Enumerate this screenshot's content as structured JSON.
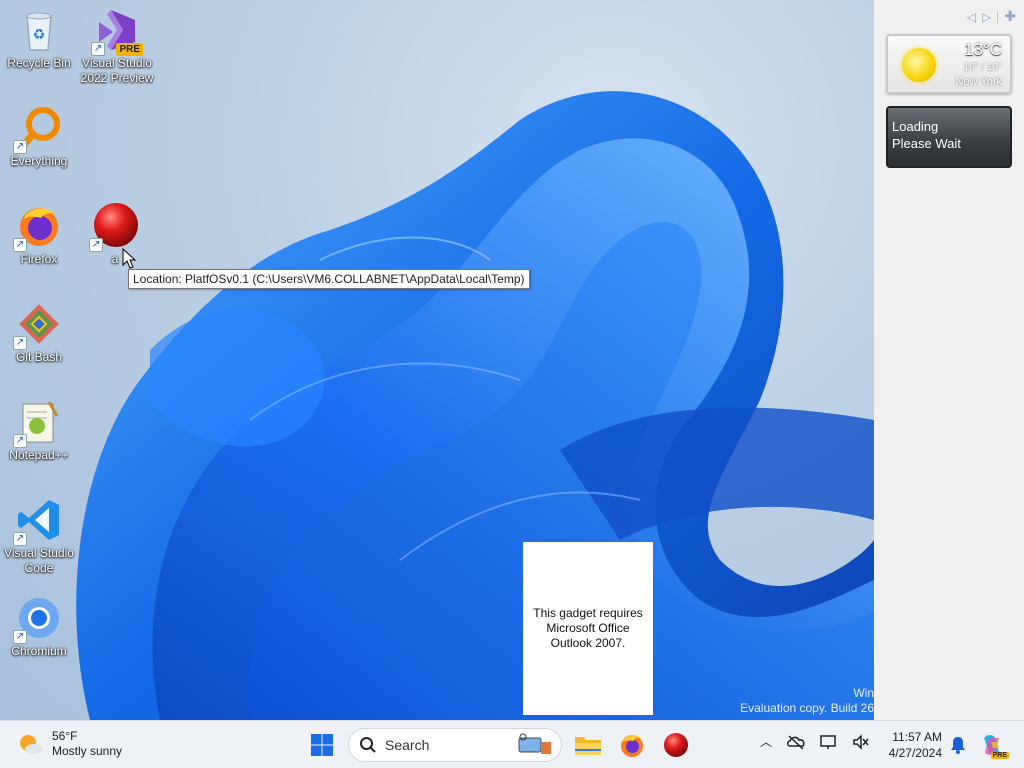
{
  "desktop": {
    "icons": [
      {
        "label": "Recycle Bin",
        "icon": "recycle-bin-icon"
      },
      {
        "label": "Visual Studio 2022 Preview",
        "icon": "visual-studio-icon",
        "badge": "PRE"
      },
      {
        "label": "Everything",
        "icon": "everything-search-icon"
      },
      {
        "label": "Firefox",
        "icon": "firefox-icon"
      },
      {
        "label": "a",
        "icon": "red-ball-icon"
      },
      {
        "label": "Git Bash",
        "icon": "git-bash-icon"
      },
      {
        "label": "Notepad++",
        "icon": "notepadpp-icon"
      },
      {
        "label": "Visual Studio Code",
        "icon": "vscode-icon"
      },
      {
        "label": "Chromium",
        "icon": "chromium-icon"
      }
    ],
    "tooltip": "Location: PlatfOSv0.1 (C:\\Users\\VM6.COLLABNET\\AppData\\Local\\Temp)",
    "outlook_gadget_text": "This gadget requires Microsoft Office Outlook 2007.",
    "watermark": {
      "line1": "Win",
      "line2": "Evaluation copy. Build 26"
    }
  },
  "sidebar": {
    "weather": {
      "temp": "13°C",
      "range": "16° / 10°",
      "city": "New York"
    },
    "loading": {
      "line1": "Loading",
      "line2": "Please Wait"
    }
  },
  "taskbar": {
    "weather": {
      "temp": "56°F",
      "condition": "Mostly sunny"
    },
    "search_placeholder": "Search",
    "clock": {
      "time": "11:57 AM",
      "date": "4/27/2024"
    },
    "copilot_badge": "PRE"
  },
  "colors": {
    "accent_blue": "#1a6ce8",
    "wallpaper_blue": "#1e63d6"
  }
}
